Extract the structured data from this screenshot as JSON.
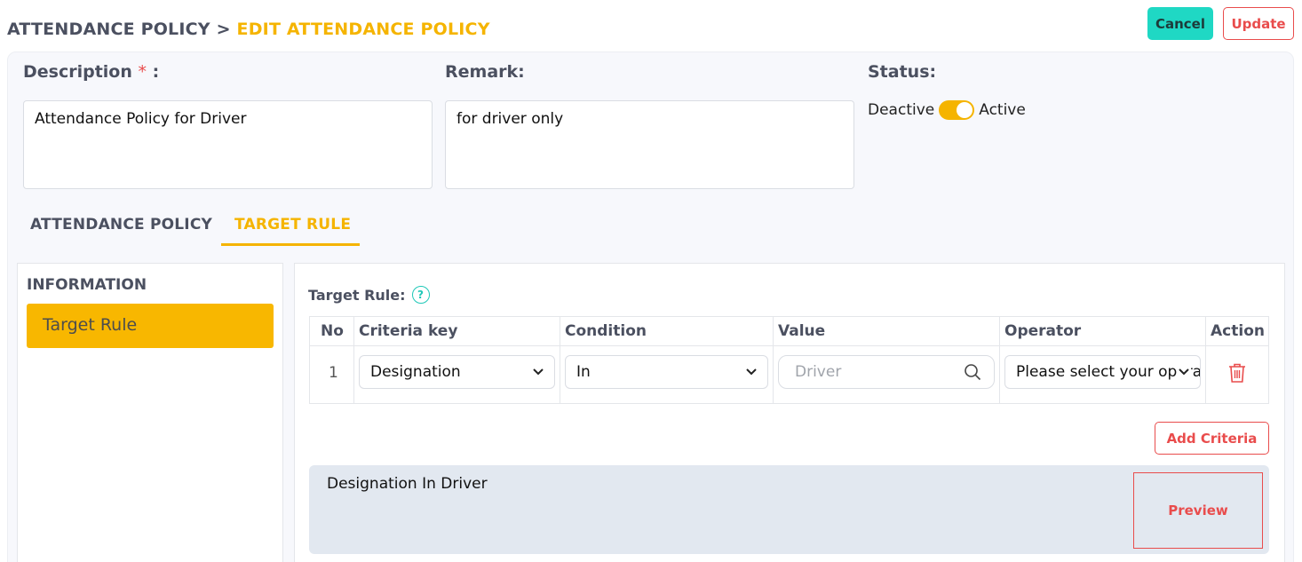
{
  "breadcrumb": {
    "root": "ATTENDANCE POLICY",
    "separator": ">",
    "current": "EDIT ATTENDANCE POLICY"
  },
  "actions": {
    "cancel": "Cancel",
    "update": "Update"
  },
  "form": {
    "description": {
      "label": "Description",
      "required_mark": "*",
      "colon": ":",
      "value": "Attendance Policy for Driver"
    },
    "remark": {
      "label": "Remark:",
      "value": "for driver only"
    },
    "status": {
      "label": "Status:",
      "off_label": "Deactive",
      "on_label": "Active",
      "active": true
    }
  },
  "tabs": [
    {
      "label": "ATTENDANCE POLICY",
      "active": false
    },
    {
      "label": "TARGET RULE",
      "active": true
    }
  ],
  "side_panel": {
    "title": "INFORMATION",
    "items": [
      {
        "label": "Target Rule",
        "active": true
      }
    ]
  },
  "target_rule": {
    "label": "Target Rule:",
    "help_glyph": "?",
    "columns": [
      "No",
      "Criteria key",
      "Condition",
      "Value",
      "Operator",
      "Action"
    ],
    "rows": [
      {
        "no": "1",
        "criteria_key": "Designation",
        "condition": "In",
        "value_placeholder": "Driver",
        "operator": "Please select your operator"
      }
    ],
    "add_button": "Add Criteria",
    "preview_text": "Designation In Driver",
    "preview_button": "Preview"
  },
  "colors": {
    "accent": "#f5b400",
    "cancel": "#1fd8c4",
    "danger": "#e94c4c",
    "help": "#1fc8b8"
  },
  "icons": {
    "help": "help-circle-icon",
    "dropdown": "chevron-down-icon",
    "search": "search-icon",
    "delete": "trash-icon"
  }
}
